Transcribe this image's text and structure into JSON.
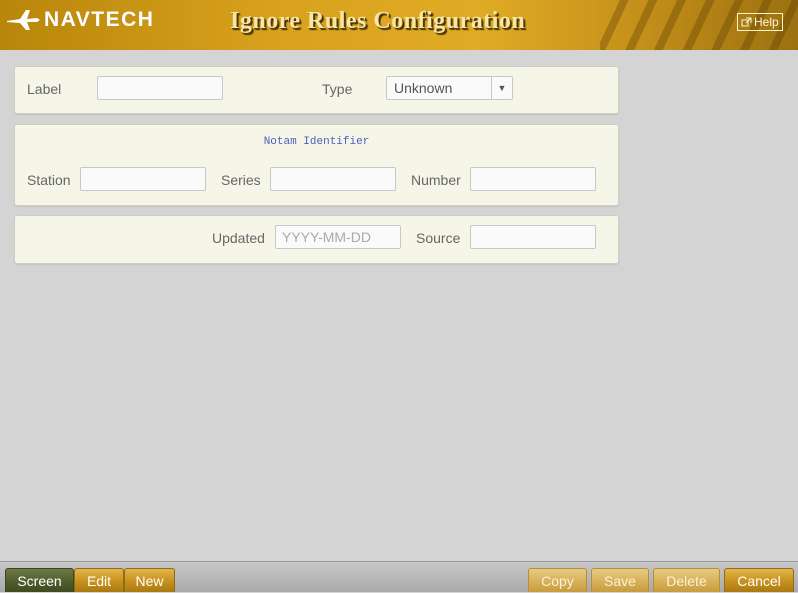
{
  "header": {
    "logo_text": "NAVTECH",
    "title": "Ignore Rules Configuration",
    "help_label": "Help",
    "help_icon": "external-link-icon"
  },
  "form": {
    "label": {
      "label": "Label",
      "value": ""
    },
    "type": {
      "label": "Type",
      "selected": "Unknown"
    },
    "notam": {
      "title": "Notam Identifier",
      "station": {
        "label": "Station",
        "value": ""
      },
      "series": {
        "label": "Series",
        "value": ""
      },
      "number": {
        "label": "Number",
        "value": ""
      }
    },
    "updated": {
      "label": "Updated",
      "placeholder": "YYYY-MM-DD",
      "value": ""
    },
    "source": {
      "label": "Source",
      "value": ""
    }
  },
  "footer": {
    "left": [
      {
        "label": "Screen",
        "state": "active"
      },
      {
        "label": "Edit",
        "state": "normal"
      },
      {
        "label": "New",
        "state": "normal"
      }
    ],
    "right": [
      {
        "label": "Copy",
        "state": "disabled"
      },
      {
        "label": "Save",
        "state": "disabled"
      },
      {
        "label": "Delete",
        "state": "disabled"
      },
      {
        "label": "Cancel",
        "state": "normal"
      }
    ]
  },
  "colors": {
    "header_gold": "#d9a21d",
    "panel_bg": "#f6f6e8",
    "page_bg": "#d4d4d4",
    "notam_title": "#4a5ec0"
  }
}
